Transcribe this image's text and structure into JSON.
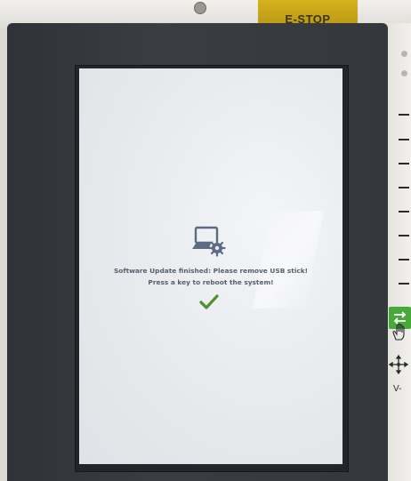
{
  "device": {
    "estop_label": "E-STOP"
  },
  "screen": {
    "icon": "laptop-gear-icon",
    "message_line1": "Software Update finished: Please remove USB stick!",
    "message_line2": "Press a key to reboot the system!",
    "status_icon": "checkmark-icon",
    "colors": {
      "text": "#55606e",
      "check": "#4f8f2f",
      "icon": "#5b6b82"
    }
  },
  "side_panel": {
    "mode_key_icon": "cycle-arrows-icon",
    "hand_key_icon": "hand-icon",
    "jog_key_icon": "jog-arrows-icon",
    "velocity_label": "V-",
    "colors": {
      "mode_key": "#49a83b"
    }
  }
}
